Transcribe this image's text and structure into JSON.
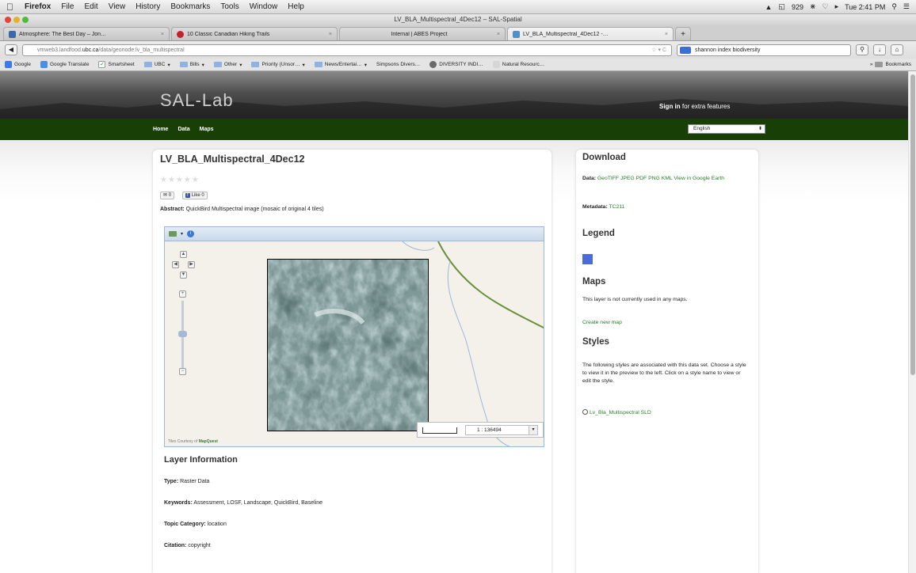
{
  "menubar": {
    "app": "Firefox",
    "items": [
      "File",
      "Edit",
      "View",
      "History",
      "Bookmarks",
      "Tools",
      "Window",
      "Help"
    ],
    "status": "929",
    "clock": "Tue 2:41 PM"
  },
  "window": {
    "title": "LV_BLA_Multispectral_4Dec12 – SAL-Spatial"
  },
  "tabs": [
    {
      "label": "Atmosphere: The Best Day – Jon…",
      "color": "#3a6aa8"
    },
    {
      "label": "10 Classic Canadian Hiking Trails",
      "color": "#c8202a"
    },
    {
      "label": "Internal | ABES Project",
      "color": "#cfcfcf"
    },
    {
      "label": "LV_BLA_Multispectral_4Dec12 -…",
      "color": "#4b92c6"
    }
  ],
  "address": {
    "url_prefix": "vmweb3.landfood.",
    "url_host": "ubc.ca",
    "url_path": "/data/geonode:lv_bla_multispectral",
    "search": "shannon index biodiversity"
  },
  "bookmarks": [
    "Google",
    "Google Translate",
    "Smartsheet",
    "UBC",
    "Bills",
    "Other",
    "Priority (Unsor…",
    "News/Entertai…",
    "Simpsons Divers…",
    "DIVERSITY INDI…",
    "Natural Resourc…",
    "Bookmarks"
  ],
  "site": {
    "logo": "SAL-Lab",
    "signin_bold": "Sign in",
    "signin_rest": " for extra features",
    "nav": [
      "Home",
      "Data",
      "Maps"
    ],
    "language": "English"
  },
  "layer": {
    "title": "LV_BLA_Multispectral_4Dec12",
    "stars": "★★★★★",
    "share_count": "0",
    "fb_label": "Like",
    "fb_count": "0",
    "abstract_label": "Abstract:",
    "abstract": " QuickBird Multispectral image (mosaic of original 4 tiles)"
  },
  "map": {
    "attribution": "Tiles Courtesy of",
    "attribution_brand": "MapQuest",
    "scale_label": "1 : 136494"
  },
  "info": {
    "heading": "Layer Information",
    "fields": [
      {
        "label": "Type:",
        "value": " Raster Data"
      },
      {
        "label": "Keywords:",
        "value": " Assessment, LOSF, Landscape, QuickBird, Baseline"
      },
      {
        "label": "Topic Category:",
        "value": " location"
      },
      {
        "label": "Citation:",
        "value": " copyright"
      }
    ]
  },
  "side": {
    "download_h": "Download",
    "data_label": "Data:",
    "data_links": " GeoTIFF JPEG PDF PNG KML View in Google Earth",
    "meta_label": "Metadata:",
    "meta_link": " TC211",
    "legend_h": "Legend",
    "legend_color": "#4b6bd8",
    "maps_h": "Maps",
    "maps_text": "This layer is not currently used in any maps.",
    "create_map": "Create new map",
    "styles_h": "Styles",
    "styles_text": "The following styles are associated with this data set. Choose a style to view it in the preview to the left. Click on a style name to view or edit the style.",
    "style_name": "Lv_Bla_Multispectral",
    "style_link": " SLD"
  }
}
